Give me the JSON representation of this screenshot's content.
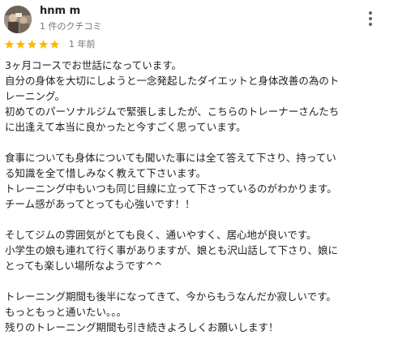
{
  "author": {
    "name": "hnm m",
    "review_count": "1 件のクチコミ"
  },
  "review": {
    "rating": 5,
    "rating_max": 5,
    "star_color": "#fbbc04",
    "date": "1 年前",
    "lines": [
      "3ヶ月コースでお世話になっています。",
      "自分の身体を大切にしようと一念発起したダイエットと身体改善の為のト",
      "レーニング。",
      "初めてのパーソナルジムで緊張しましたが、こちらのトレーナーさんたち",
      "に出逢えて本当に良かったと今すごく思っています。",
      "",
      "食事についても身体についても聞いた事には全て答えて下さり、持ってい",
      "る知識を全て惜しみなく教えて下さいます。",
      "トレーニング中もいつも同じ目線に立って下さっているのがわかります。",
      "チーム感があってとっても心強いです！！",
      "",
      "そしてジムの雰囲気がとても良く、通いやすく、居心地が良いです。",
      "小学生の娘も連れて行く事がありますが、娘とも沢山話して下さり、娘に",
      "とっても楽しい場所なようです^^",
      "",
      "トレーニング期間も後半になってきて、今からもうなんだか寂しいです。",
      "もっともっと通いたい。。。",
      "残りのトレーニング期間も引き続きよろしくお願いします！"
    ]
  },
  "icons": {
    "more": "more-vert-icon",
    "star": "star-icon",
    "avatar": "user-avatar"
  }
}
